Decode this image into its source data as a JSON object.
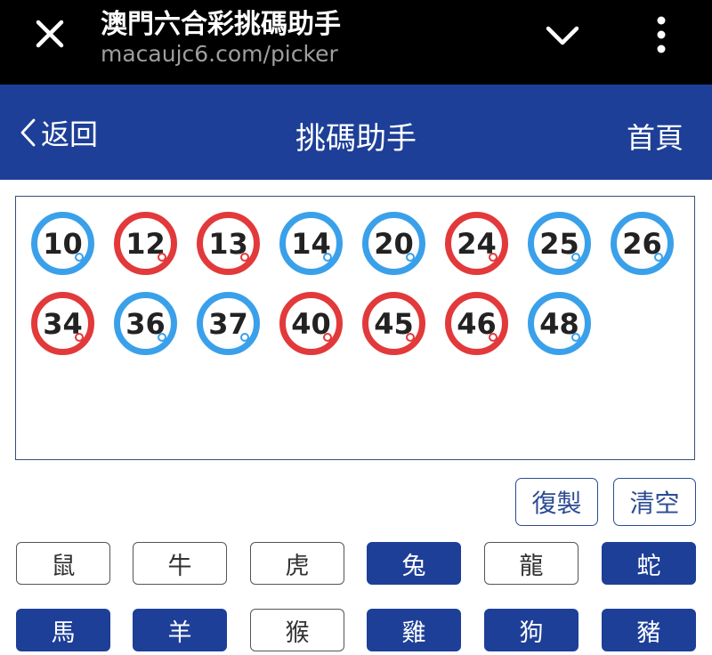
{
  "browser": {
    "title": "澳門六合彩挑碼助手",
    "url": "macaujc6.com/picker"
  },
  "header": {
    "back_label": "返回",
    "title": "挑碼助手",
    "home_label": "首頁"
  },
  "colors": {
    "brand": "#1d3f97",
    "red_ball": "#e2393b",
    "blue_ball": "#3aa0ea"
  },
  "selected_numbers": [
    {
      "num": "10",
      "color": "blue"
    },
    {
      "num": "12",
      "color": "red"
    },
    {
      "num": "13",
      "color": "red"
    },
    {
      "num": "14",
      "color": "blue"
    },
    {
      "num": "20",
      "color": "blue"
    },
    {
      "num": "24",
      "color": "red"
    },
    {
      "num": "25",
      "color": "blue"
    },
    {
      "num": "26",
      "color": "blue"
    },
    {
      "num": "34",
      "color": "red"
    },
    {
      "num": "36",
      "color": "blue"
    },
    {
      "num": "37",
      "color": "blue"
    },
    {
      "num": "40",
      "color": "red"
    },
    {
      "num": "45",
      "color": "red"
    },
    {
      "num": "46",
      "color": "red"
    },
    {
      "num": "48",
      "color": "blue"
    }
  ],
  "actions": {
    "copy_label": "復製",
    "clear_label": "清空"
  },
  "zodiac": [
    {
      "label": "鼠",
      "selected": false
    },
    {
      "label": "牛",
      "selected": false
    },
    {
      "label": "虎",
      "selected": false
    },
    {
      "label": "兔",
      "selected": true
    },
    {
      "label": "龍",
      "selected": false
    },
    {
      "label": "蛇",
      "selected": true
    },
    {
      "label": "馬",
      "selected": true
    },
    {
      "label": "羊",
      "selected": true
    },
    {
      "label": "猴",
      "selected": false
    },
    {
      "label": "雞",
      "selected": true
    },
    {
      "label": "狗",
      "selected": true
    },
    {
      "label": "豬",
      "selected": true
    }
  ]
}
